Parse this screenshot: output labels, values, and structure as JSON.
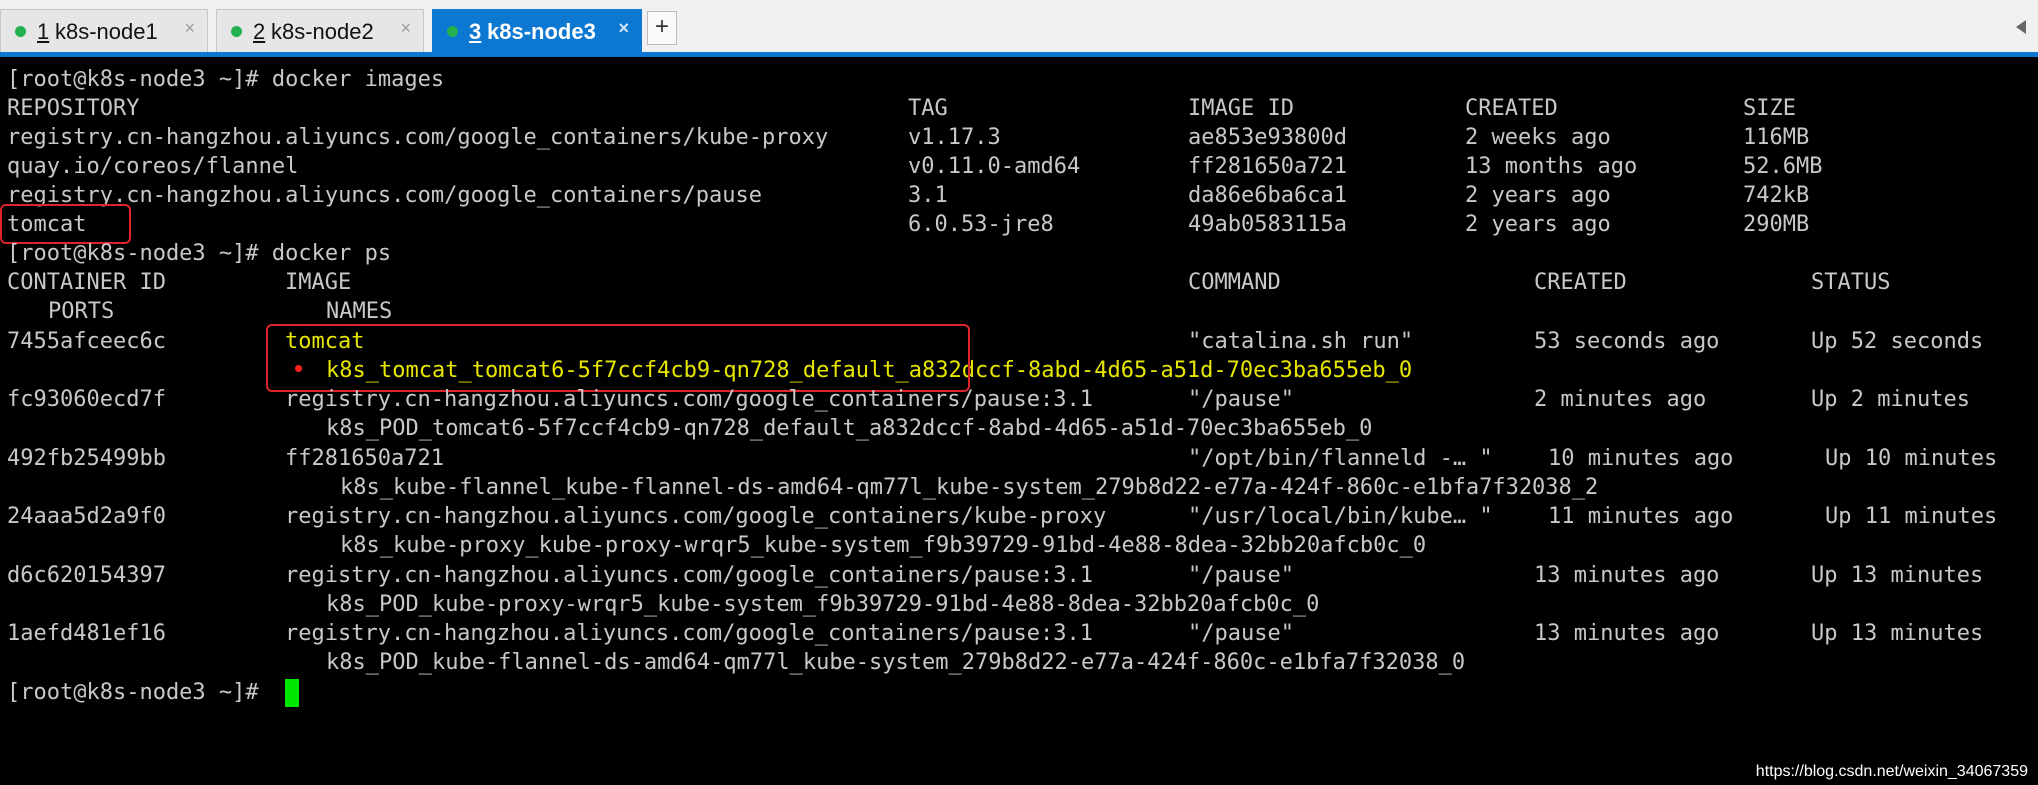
{
  "tabs": [
    {
      "number": "1",
      "name": "k8s-node1",
      "close": "×"
    },
    {
      "number": "2",
      "name": "k8s-node2",
      "close": "×"
    },
    {
      "number": "3",
      "name": "k8s-node3",
      "close": "×"
    }
  ],
  "tab_add_label": "+",
  "colors": {
    "accent": "#0d78d2",
    "status_dot": "#22b14c",
    "highlight_box": "#e0242b",
    "cursor": "#00e600",
    "highlight_text": "#e6e600"
  },
  "terminal": {
    "prompt": "[root@k8s-node3 ~]#",
    "commands": [
      "docker images",
      "docker ps"
    ],
    "images": {
      "headers": [
        "REPOSITORY",
        "TAG",
        "IMAGE ID",
        "CREATED",
        "SIZE"
      ],
      "rows": [
        [
          "registry.cn-hangzhou.aliyuncs.com/google_containers/kube-proxy",
          "v1.17.3",
          "ae853e93800d",
          "2 weeks ago",
          "116MB"
        ],
        [
          "quay.io/coreos/flannel",
          "v0.11.0-amd64",
          "ff281650a721",
          "13 months ago",
          "52.6MB"
        ],
        [
          "registry.cn-hangzhou.aliyuncs.com/google_containers/pause",
          "3.1",
          "da86e6ba6ca1",
          "2 years ago",
          "742kB"
        ],
        [
          "tomcat",
          "6.0.53-jre8",
          "49ab0583115a",
          "2 years ago",
          "290MB"
        ]
      ]
    },
    "ps": {
      "headers": [
        "CONTAINER ID",
        "IMAGE",
        "COMMAND",
        "CREATED",
        "STATUS"
      ],
      "headers2": [
        "PORTS",
        "NAMES"
      ],
      "rows": [
        [
          "7455afceec6c",
          "tomcat",
          "\"catalina.sh run\"",
          "53 seconds ago",
          "Up 52 seconds",
          "k8s_tomcat_tomcat6-5f7ccf4cb9-qn728_default_a832dccf-8abd-4d65-a51d-70ec3ba655eb_0"
        ],
        [
          "fc93060ecd7f",
          "registry.cn-hangzhou.aliyuncs.com/google_containers/pause:3.1",
          "\"/pause\"",
          "2 minutes ago",
          "Up 2 minutes",
          "k8s_POD_tomcat6-5f7ccf4cb9-qn728_default_a832dccf-8abd-4d65-a51d-70ec3ba655eb_0"
        ],
        [
          "492fb25499bb",
          "ff281650a721",
          "\"/opt/bin/flanneld -… \"",
          "10 minutes ago",
          "Up 10 minutes",
          "k8s_kube-flannel_kube-flannel-ds-amd64-qm77l_kube-system_279b8d22-e77a-424f-860c-e1bfa7f32038_2"
        ],
        [
          "24aaa5d2a9f0",
          "registry.cn-hangzhou.aliyuncs.com/google_containers/kube-proxy",
          "\"/usr/local/bin/kube… \"",
          "11 minutes ago",
          "Up 11 minutes",
          "k8s_kube-proxy_kube-proxy-wrqr5_kube-system_f9b39729-91bd-4e88-8dea-32bb20afcb0c_0"
        ],
        [
          "d6c620154397",
          "registry.cn-hangzhou.aliyuncs.com/google_containers/pause:3.1",
          "\"/pause\"",
          "13 minutes ago",
          "Up 13 minutes",
          "k8s_POD_kube-proxy-wrqr5_kube-system_f9b39729-91bd-4e88-8dea-32bb20afcb0c_0"
        ],
        [
          "1aefd481ef16",
          "registry.cn-hangzhou.aliyuncs.com/google_containers/pause:3.1",
          "\"/pause\"",
          "13 minutes ago",
          "Up 13 minutes",
          "k8s_POD_kube-flannel-ds-amd64-qm77l_kube-system_279b8d22-e77a-424f-860c-e1bfa7f32038_0"
        ]
      ]
    }
  },
  "watermark": "https://blog.csdn.net/weixin_34067359"
}
